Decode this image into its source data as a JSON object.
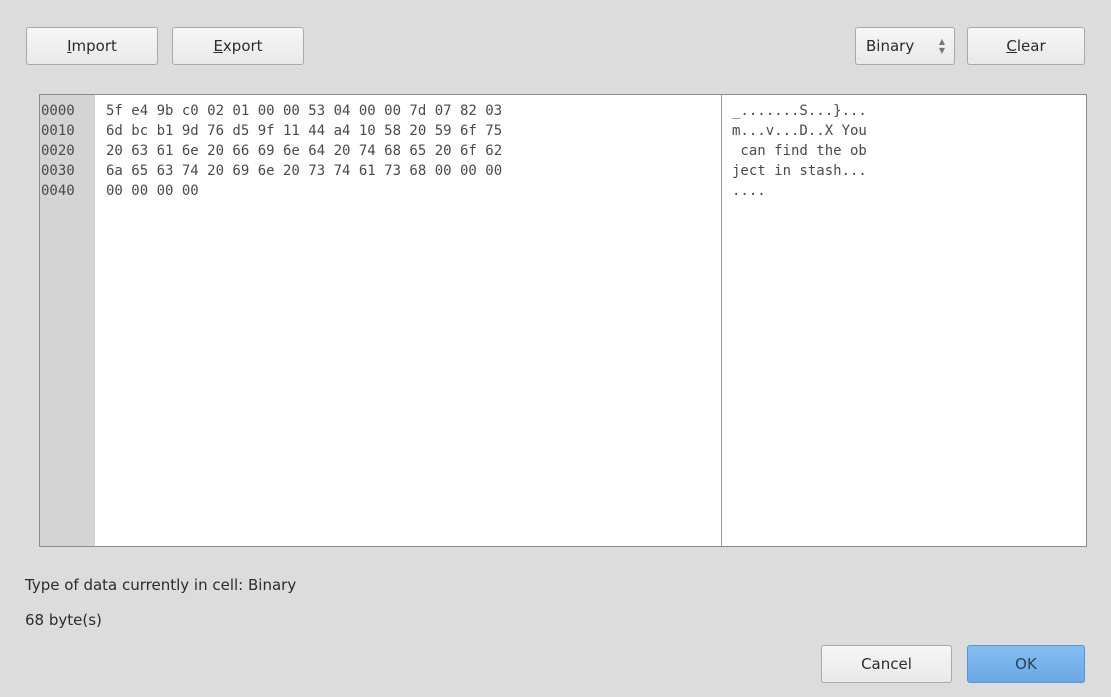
{
  "toolbar": {
    "import_mnemonic": "I",
    "import_rest": "mport",
    "export_mnemonic": "E",
    "export_rest": "xport",
    "mode_value": "Binary",
    "clear_mnemonic": "C",
    "clear_rest": "lear"
  },
  "hex_editor": {
    "rows": [
      {
        "address": "0000",
        "hex": "5f e4 9b c0 02 01 00 00 53 04 00 00 7d 07 82 03",
        "ascii": "_.......S...}..."
      },
      {
        "address": "0010",
        "hex": "6d bc b1 9d 76 d5 9f 11 44 a4 10 58 20 59 6f 75",
        "ascii": "m...v...D..X You"
      },
      {
        "address": "0020",
        "hex": "20 63 61 6e 20 66 69 6e 64 20 74 68 65 20 6f 62",
        "ascii": " can find the ob"
      },
      {
        "address": "0030",
        "hex": "6a 65 63 74 20 69 6e 20 73 74 61 73 68 00 00 00",
        "ascii": "ject in stash..."
      },
      {
        "address": "0040",
        "hex": "00 00 00 00",
        "ascii": "...."
      }
    ]
  },
  "info": {
    "type_text": "Type of data currently in cell: Binary",
    "size_text": "68 byte(s)"
  },
  "footer": {
    "cancel_label": "Cancel",
    "ok_label": "OK"
  },
  "colors": {
    "ok_accent": "#6aa8e6",
    "background": "#dcdcdc",
    "address_gutter": "#d4d4d4"
  }
}
